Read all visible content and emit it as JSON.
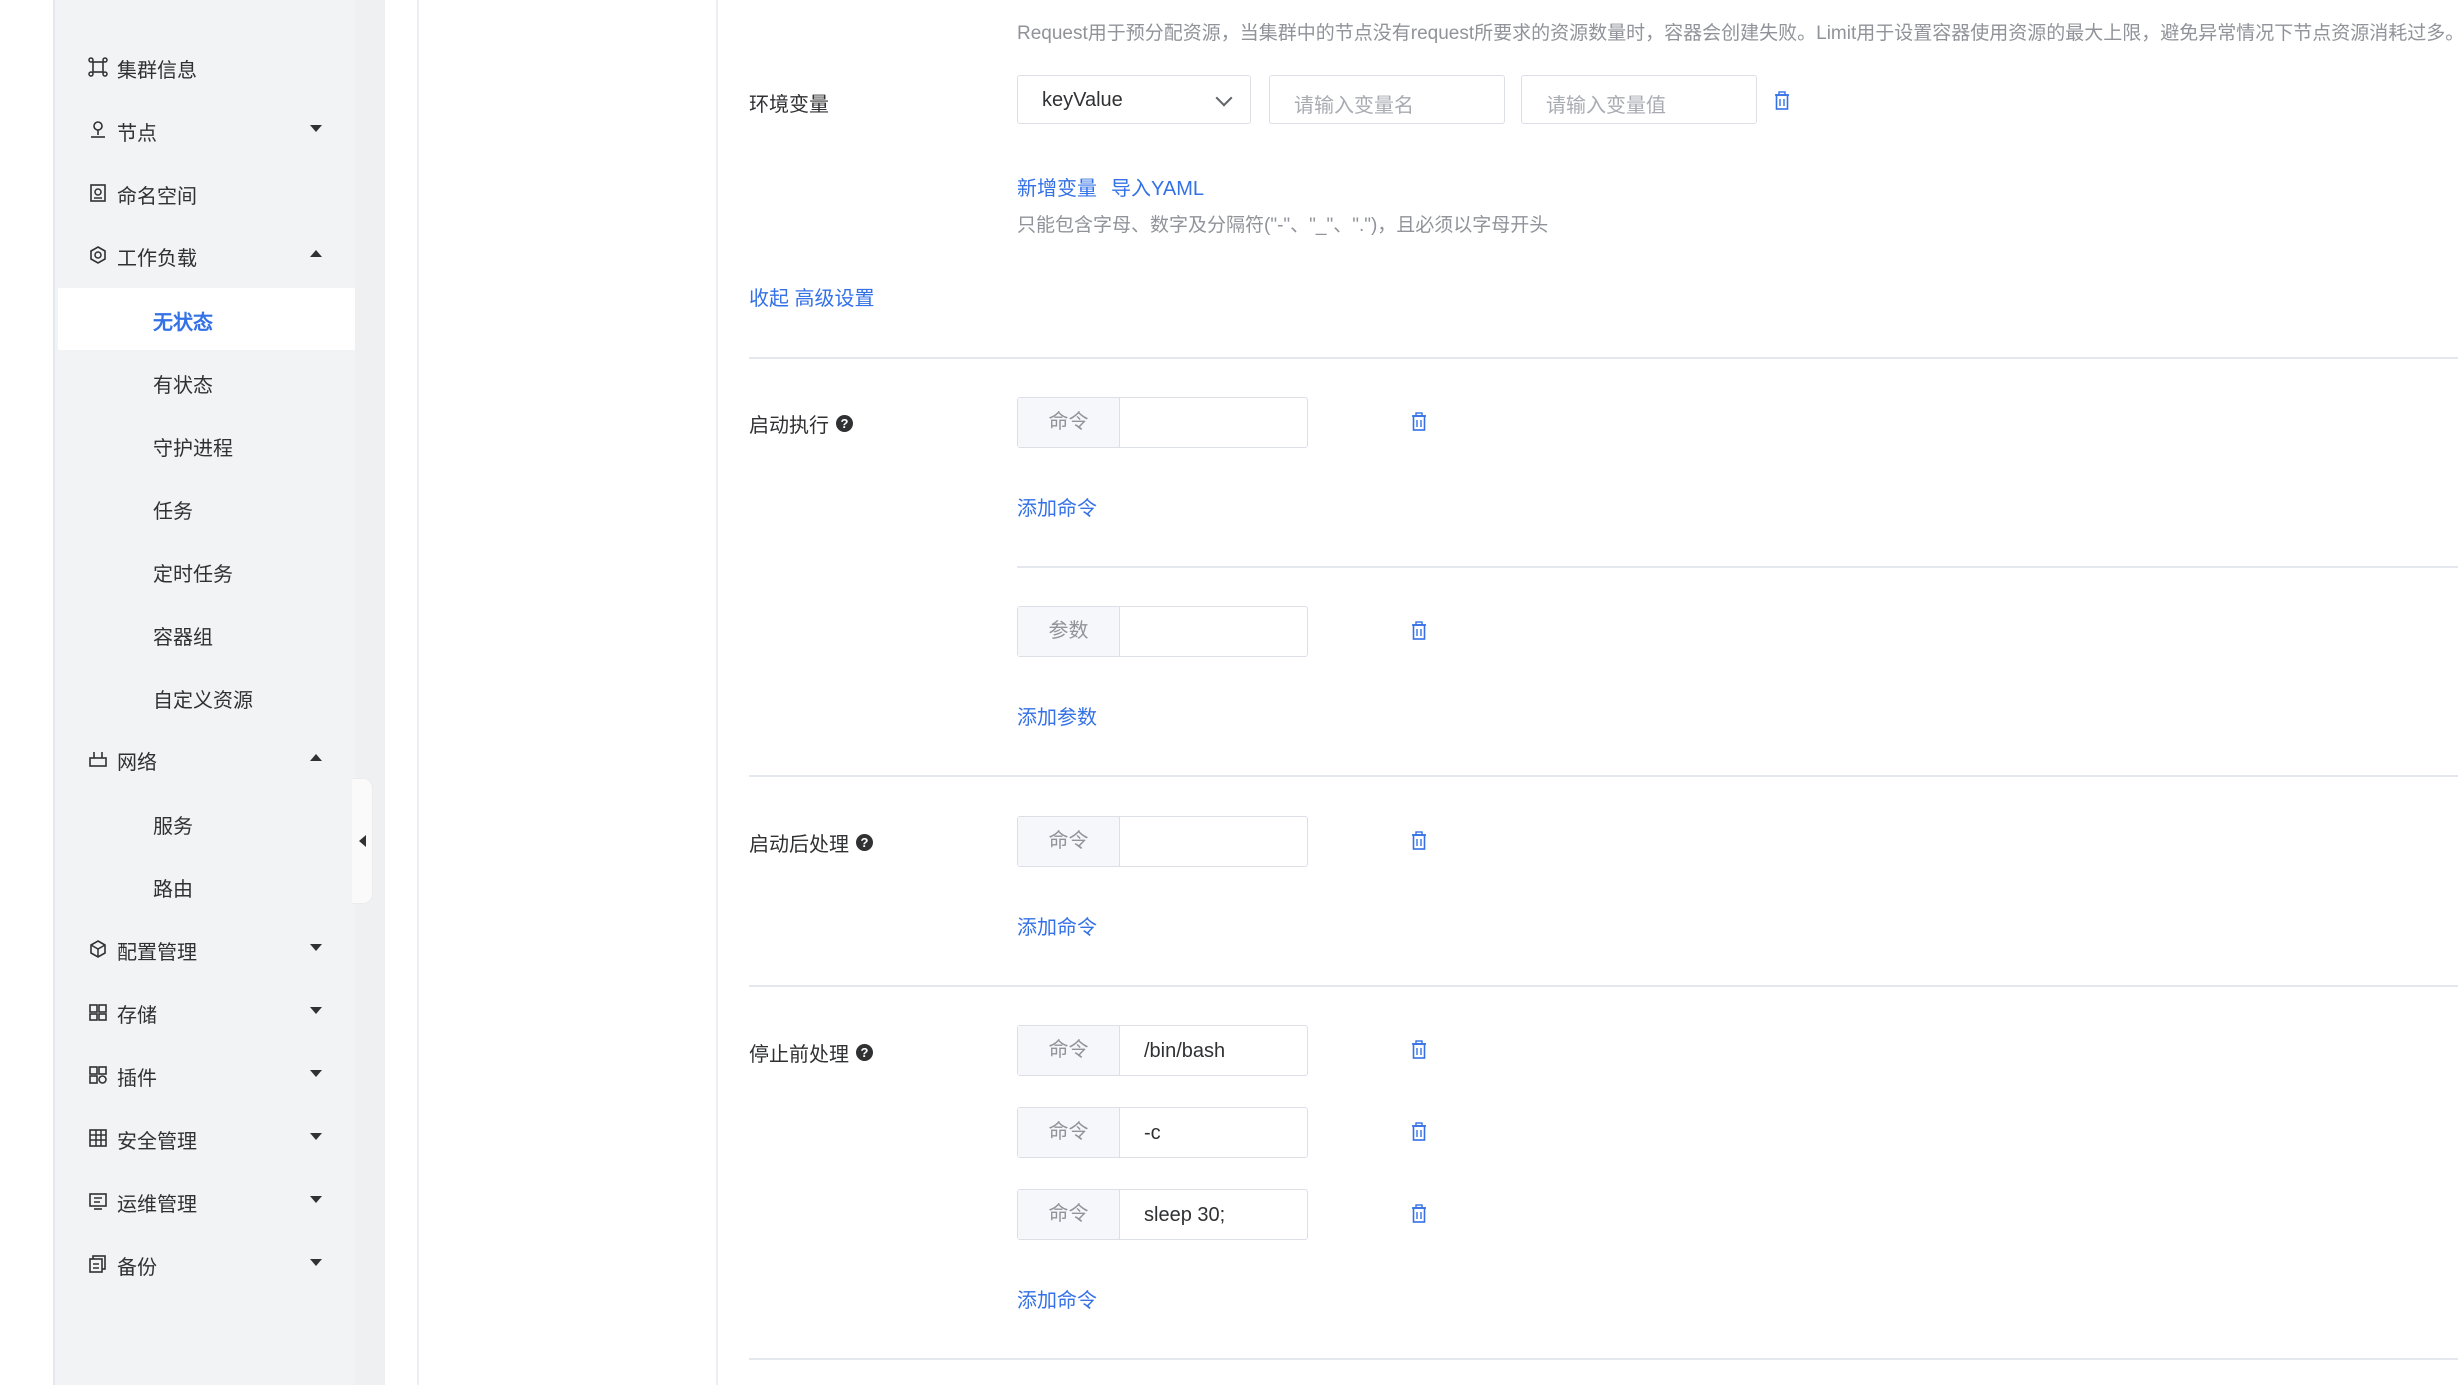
{
  "sidebar": {
    "items": [
      {
        "label": "集群信息",
        "icon": "cluster-icon",
        "caret": ""
      },
      {
        "label": "节点",
        "icon": "node-icon",
        "caret": "down"
      },
      {
        "label": "命名空间",
        "icon": "namespace-icon",
        "caret": ""
      },
      {
        "label": "工作负载",
        "icon": "workload-icon",
        "caret": "up"
      },
      {
        "label": "网络",
        "icon": "network-icon",
        "caret": "up"
      },
      {
        "label": "配置管理",
        "icon": "config-icon",
        "caret": "down"
      },
      {
        "label": "存储",
        "icon": "storage-icon",
        "caret": "down"
      },
      {
        "label": "插件",
        "icon": "plugin-icon",
        "caret": "down"
      },
      {
        "label": "安全管理",
        "icon": "security-icon",
        "caret": "down"
      },
      {
        "label": "运维管理",
        "icon": "ops-icon",
        "caret": "down"
      },
      {
        "label": "备份",
        "icon": "backup-icon",
        "caret": "down"
      }
    ],
    "workload_sub": [
      "无状态",
      "有状态",
      "守护进程",
      "任务",
      "定时任务",
      "容器组",
      "自定义资源"
    ],
    "network_sub": [
      "服务",
      "路由"
    ],
    "active_sub": "无状态"
  },
  "form": {
    "resource_hint": "Request用于预分配资源，当集群中的节点没有request所要求的资源数量时，容器会创建失败。Limit用于设置容器使用资源的最大上限，避免异常情况下节点资源消耗过多。",
    "env": {
      "label": "环境变量",
      "type_value": "keyValue",
      "name_placeholder": "请输入变量名",
      "value_placeholder": "请输入变量值",
      "add_link": "新增变量",
      "import_link": "导入YAML",
      "hint": "只能包含字母、数字及分隔符(\"-\"、\"_\"、\".\")，且必须以字母开头"
    },
    "collapse_link": "收起 高级设置",
    "startup": {
      "label": "启动执行",
      "cmd_prefix": "命令",
      "cmd_value": "",
      "add_cmd": "添加命令",
      "arg_prefix": "参数",
      "arg_value": "",
      "add_arg": "添加参数"
    },
    "post_start": {
      "label": "启动后处理",
      "cmd_prefix": "命令",
      "cmd_value": "",
      "add_cmd": "添加命令"
    },
    "pre_stop": {
      "label": "停止前处理",
      "commands": [
        {
          "prefix": "命令",
          "value": "/bin/bash"
        },
        {
          "prefix": "命令",
          "value": "-c"
        },
        {
          "prefix": "命令",
          "value": "sleep 30;"
        }
      ],
      "add_cmd": "添加命令"
    },
    "help_glyph": "?"
  },
  "colors": {
    "accent": "#3471e6",
    "sidebar_bg": "#f2f3f5"
  }
}
